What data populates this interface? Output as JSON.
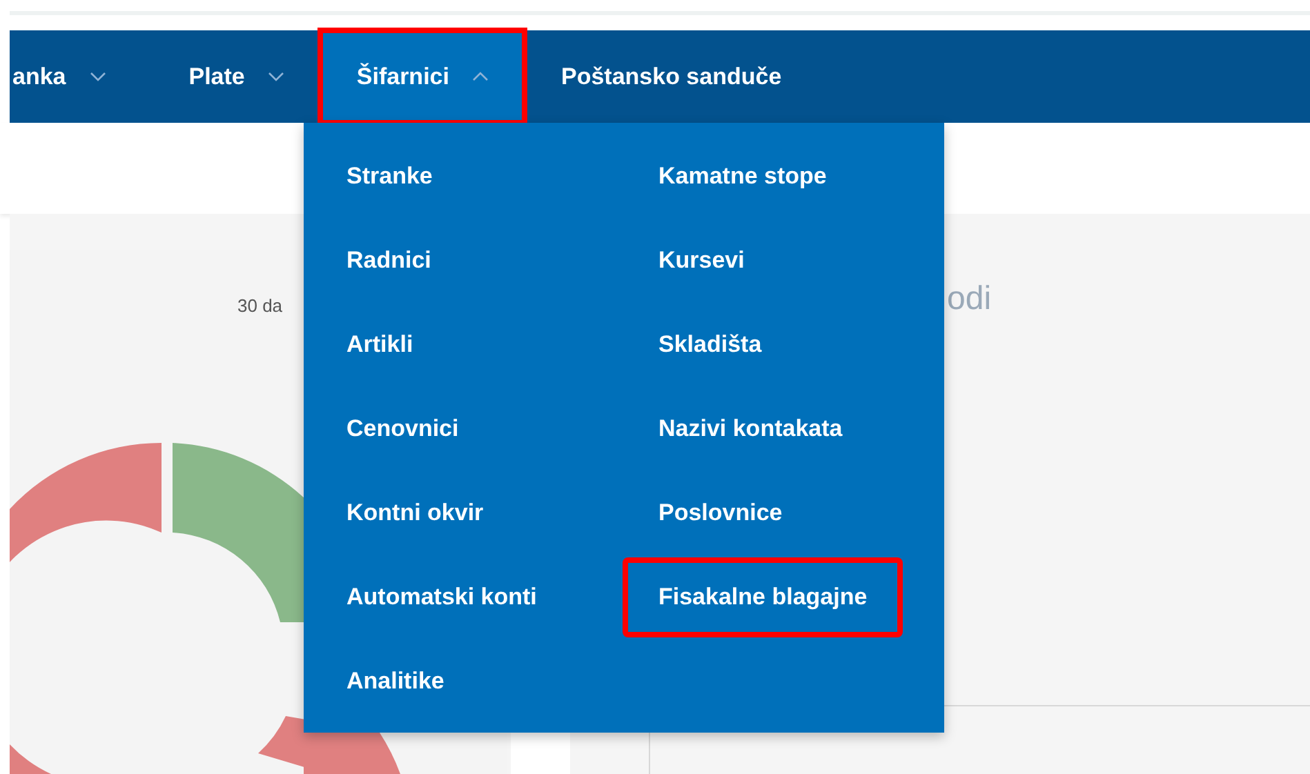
{
  "nav": {
    "items": [
      {
        "label": "anka",
        "has_caret": true,
        "expanded": false,
        "selected": false,
        "annotated": false
      },
      {
        "label": "Plate",
        "has_caret": true,
        "expanded": false,
        "selected": false,
        "annotated": false
      },
      {
        "label": "Šifarnici",
        "has_caret": true,
        "expanded": true,
        "selected": true,
        "annotated": true
      },
      {
        "label": "Poštansko sanduče",
        "has_caret": false,
        "selected": false,
        "annotated": false
      }
    ]
  },
  "dropdown": {
    "columns": [
      [
        {
          "label": "Stranke",
          "annotated": false
        },
        {
          "label": "Radnici",
          "annotated": false
        },
        {
          "label": "Artikli",
          "annotated": false
        },
        {
          "label": "Cenovnici",
          "annotated": false
        },
        {
          "label": "Kontni okvir",
          "annotated": false
        },
        {
          "label": "Automatski konti",
          "annotated": false
        },
        {
          "label": "Analitike",
          "annotated": false
        }
      ],
      [
        {
          "label": "Kamatne stope",
          "annotated": false
        },
        {
          "label": "Kursevi",
          "annotated": false
        },
        {
          "label": "Skladišta",
          "annotated": false
        },
        {
          "label": "Nazivi kontakata",
          "annotated": false
        },
        {
          "label": "Poslovnice",
          "annotated": false
        },
        {
          "label": "Fisakalne blagajne",
          "annotated": true
        }
      ]
    ]
  },
  "background": {
    "chart_caption": "30 da",
    "panel_title": "odi"
  }
}
